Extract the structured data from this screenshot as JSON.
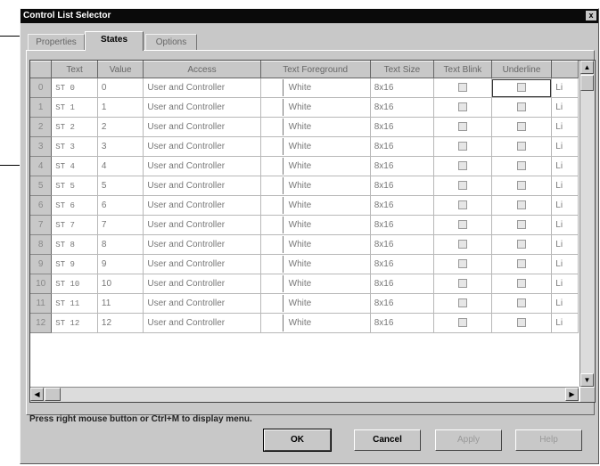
{
  "window": {
    "title": "Control List Selector",
    "close_glyph": "x"
  },
  "tabs": [
    {
      "label": "Properties",
      "active": false
    },
    {
      "label": "States",
      "active": true
    },
    {
      "label": "Options",
      "active": false
    }
  ],
  "grid": {
    "columns": [
      "",
      "Text",
      "Value",
      "Access",
      "Text Foreground",
      "Text Size",
      "Text Blink",
      "Underline",
      ""
    ],
    "rows": [
      {
        "num": "0",
        "text": "ST 0",
        "value": "0",
        "access": "User and Controller",
        "fg": "White",
        "size": "8x16",
        "more": "Li"
      },
      {
        "num": "1",
        "text": "ST 1",
        "value": "1",
        "access": "User and Controller",
        "fg": "White",
        "size": "8x16",
        "more": "Li"
      },
      {
        "num": "2",
        "text": "ST 2",
        "value": "2",
        "access": "User and Controller",
        "fg": "White",
        "size": "8x16",
        "more": "Li"
      },
      {
        "num": "3",
        "text": "ST 3",
        "value": "3",
        "access": "User and Controller",
        "fg": "White",
        "size": "8x16",
        "more": "Li"
      },
      {
        "num": "4",
        "text": "ST 4",
        "value": "4",
        "access": "User and Controller",
        "fg": "White",
        "size": "8x16",
        "more": "Li"
      },
      {
        "num": "5",
        "text": "ST 5",
        "value": "5",
        "access": "User and Controller",
        "fg": "White",
        "size": "8x16",
        "more": "Li"
      },
      {
        "num": "6",
        "text": "ST 6",
        "value": "6",
        "access": "User and Controller",
        "fg": "White",
        "size": "8x16",
        "more": "Li"
      },
      {
        "num": "7",
        "text": "ST 7",
        "value": "7",
        "access": "User and Controller",
        "fg": "White",
        "size": "8x16",
        "more": "Li"
      },
      {
        "num": "8",
        "text": "ST 8",
        "value": "8",
        "access": "User and Controller",
        "fg": "White",
        "size": "8x16",
        "more": "Li"
      },
      {
        "num": "9",
        "text": "ST 9",
        "value": "9",
        "access": "User and Controller",
        "fg": "White",
        "size": "8x16",
        "more": "Li"
      },
      {
        "num": "10",
        "text": "ST 10",
        "value": "10",
        "access": "User and Controller",
        "fg": "White",
        "size": "8x16",
        "more": "Li"
      },
      {
        "num": "11",
        "text": "ST 11",
        "value": "11",
        "access": "User and Controller",
        "fg": "White",
        "size": "8x16",
        "more": "Li"
      },
      {
        "num": "12",
        "text": "ST 12",
        "value": "12",
        "access": "User and Controller",
        "fg": "White",
        "size": "8x16",
        "more": "Li"
      }
    ]
  },
  "status_text": "Press right mouse button or Ctrl+M to display menu.",
  "buttons": {
    "ok": "OK",
    "cancel": "Cancel",
    "apply": "Apply",
    "help": "Help"
  }
}
